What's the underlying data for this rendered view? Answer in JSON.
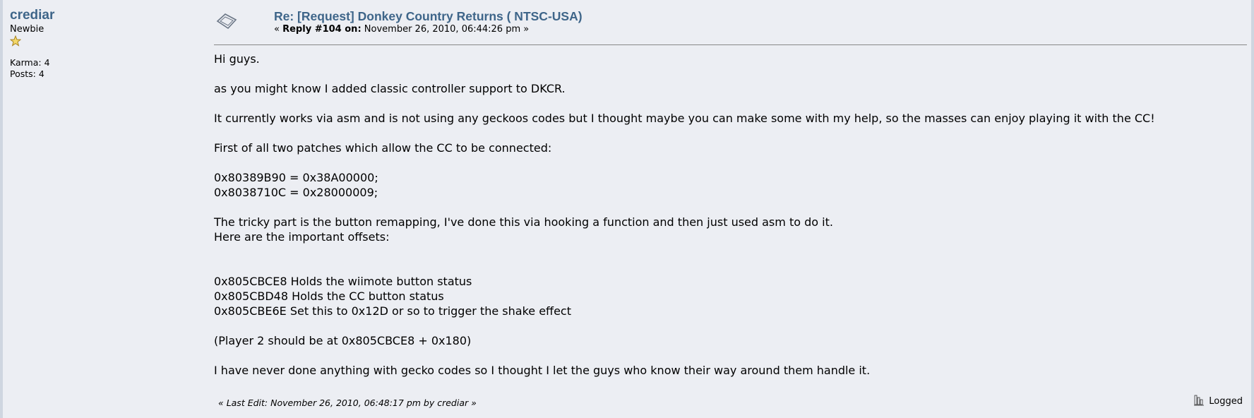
{
  "poster": {
    "name": "crediar",
    "group": "Newbie",
    "karma": "Karma: 4",
    "posts": "Posts: 4"
  },
  "post": {
    "title": "Re: [Request] Donkey Country Returns ( NTSC-USA)",
    "reply_prefix": "«",
    "reply_label": "Reply #104 on:",
    "reply_date": "November 26, 2010, 06:44:26 pm »",
    "body": {
      "p1": "Hi guys.",
      "p2": "as you might know I added classic controller support to DKCR.",
      "p3": "It currently works via asm and is not using any geckoos codes but I thought maybe you can make some with my help, so the masses can enjoy playing it with the CC!",
      "p4": "First of all two patches which allow the CC to be connected:",
      "code1": "0x80389B90 = 0x38A00000;",
      "code2": "0x8038710C = 0x28000009;",
      "p5a": "The tricky part is the button remapping, I've done this via hooking a function and then just used asm to do it.",
      "p5b": "Here are the important offsets:",
      "off1": "0x805CBCE8 Holds the wiimote button status",
      "off2": "0x805CBD48 Holds the CC button status",
      "off3": "0x805CBE6E Set this to 0x12D or so to trigger the shake effect",
      "p6": "(Player 2 should be at 0x805CBCE8 + 0x180)",
      "p7": "I have never done anything with gecko codes so I thought I let the guys who know their way around them handle it."
    },
    "last_edit": "« Last Edit: November 26, 2010, 06:48:17 pm by crediar »",
    "logged": "Logged"
  },
  "icons": {
    "topic": "xx-post-icon",
    "rank": "star-icon",
    "logged": "ip-logged-icon"
  },
  "colors": {
    "link": "#3e6589",
    "background": "#eceef3"
  }
}
